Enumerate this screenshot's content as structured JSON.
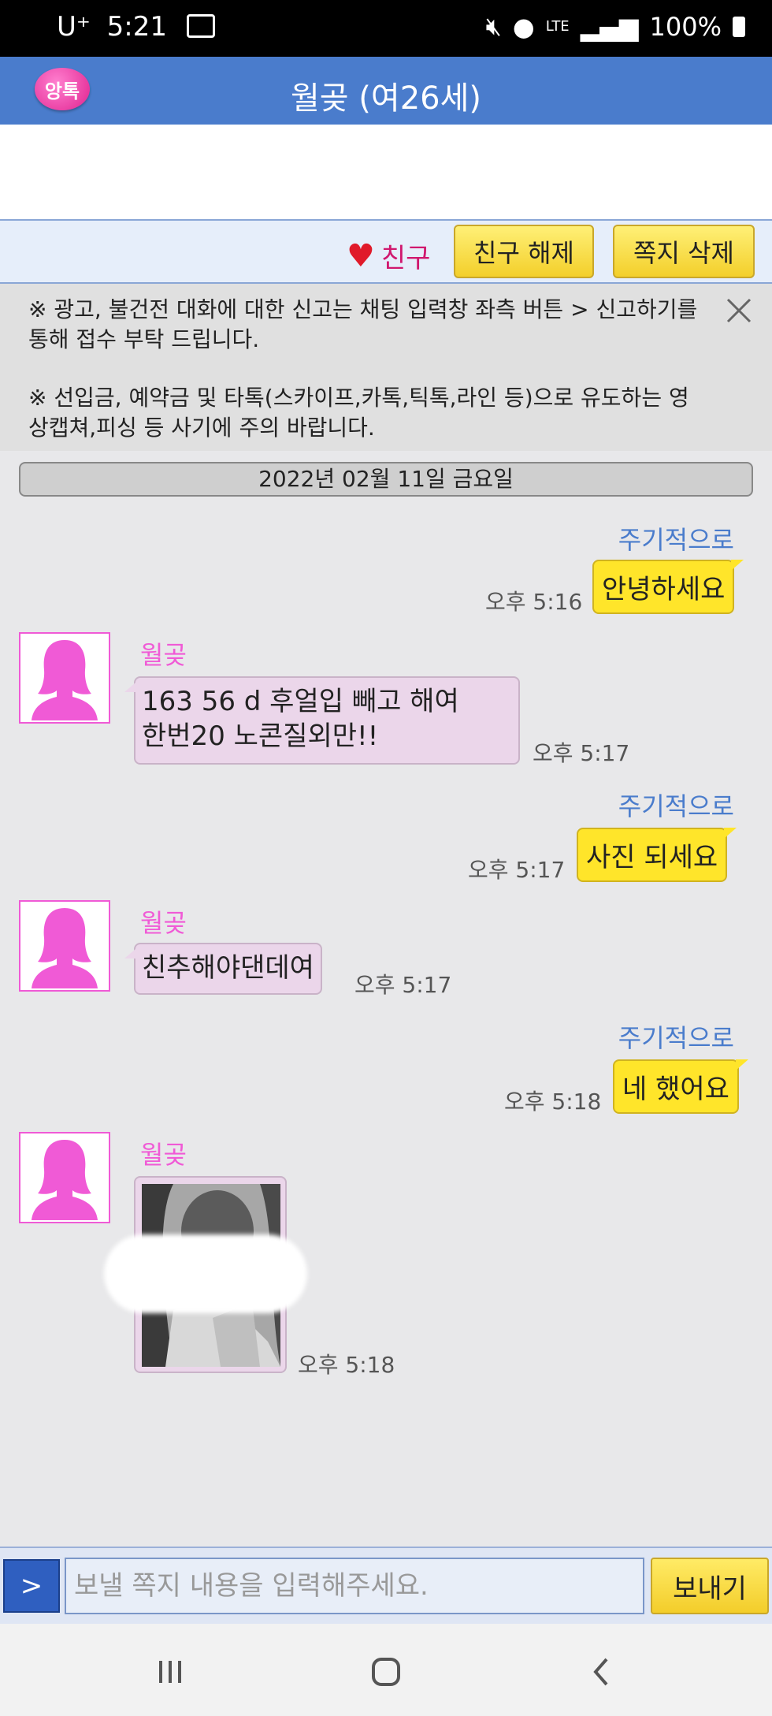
{
  "status_bar": {
    "carrier": "U⁺",
    "time": "5:21",
    "network": "LTE",
    "battery": "100%"
  },
  "app_bar": {
    "logo_text": "앙톡",
    "title": "월곶 (여26세)"
  },
  "friend_bar": {
    "friend_label": "친구",
    "unfriend_button": "친구 해제",
    "delete_button": "쪽지 삭제"
  },
  "notice": {
    "line1": "※ 광고, 불건전 대화에 대한 신고는 채팅 입력창 좌측 버튼 > 신고하기를 통해 접수 부탁 드립니다.",
    "line2": "※ 선입금, 예약금 및 타톡(스카이프,카톡,틱톡,라인 등)으로 유도하는 영상캡쳐,피싱 등 사기에 주의 바랍니다."
  },
  "date_divider": "2022년 02월 11일 금요일",
  "messages": [
    {
      "from": "me",
      "name": "주기적으로",
      "text": "안녕하세요",
      "time": "오후 5:16"
    },
    {
      "from": "other",
      "name": "월곶",
      "text_line1": "163 56 d 후얼입 빼고 해여",
      "text_line2": "한번20 노콘질외만!!",
      "time": "오후 5:17"
    },
    {
      "from": "me",
      "name": "주기적으로",
      "text": "사진 되세요",
      "time": "오후 5:17"
    },
    {
      "from": "other",
      "name": "월곶",
      "text": "친추해야댄데여",
      "time": "오후 5:17"
    },
    {
      "from": "me",
      "name": "주기적으로",
      "text": "네 했어요",
      "time": "오후 5:18"
    },
    {
      "from": "other",
      "name": "월곶",
      "type": "photo",
      "time": "오후 5:18"
    }
  ],
  "input_bar": {
    "menu_button": ">",
    "placeholder": "보낼 쪽지 내용을 입력해주세요.",
    "send_button": "보내기"
  },
  "colors": {
    "app_bar": "#4a7ccc",
    "my_bubble": "#ffe52a",
    "other_bubble": "#ebd6ea",
    "other_name": "#f05ad6",
    "my_name": "#4a7ccc"
  }
}
